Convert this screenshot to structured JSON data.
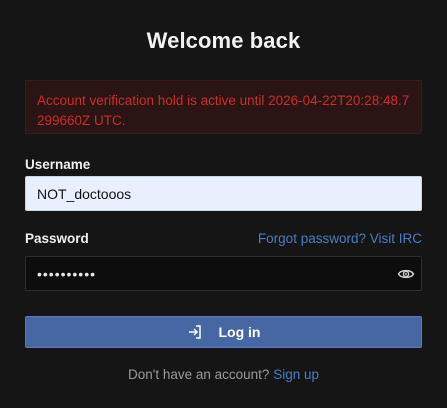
{
  "header": {
    "title": "Welcome back"
  },
  "alert": {
    "message": "Account verification hold is active until 2026-04-22T20:28:48.7299660Z UTC."
  },
  "username": {
    "label": "Username",
    "value": "NOT_doctooos"
  },
  "password": {
    "label": "Password",
    "value": "••••••••••",
    "forgot_link": "Forgot password? Visit IRC",
    "toggle_icon": "eye-icon"
  },
  "login_button": {
    "label": "Log in",
    "icon": "login-icon"
  },
  "footer": {
    "prompt": "Don't have an account?",
    "signup_link": "Sign up"
  },
  "colors": {
    "background": "#151515",
    "accent": "#4667a3",
    "link": "#4d7bc4",
    "error_text": "#cf2c2c",
    "error_bg": "#2a1414"
  }
}
